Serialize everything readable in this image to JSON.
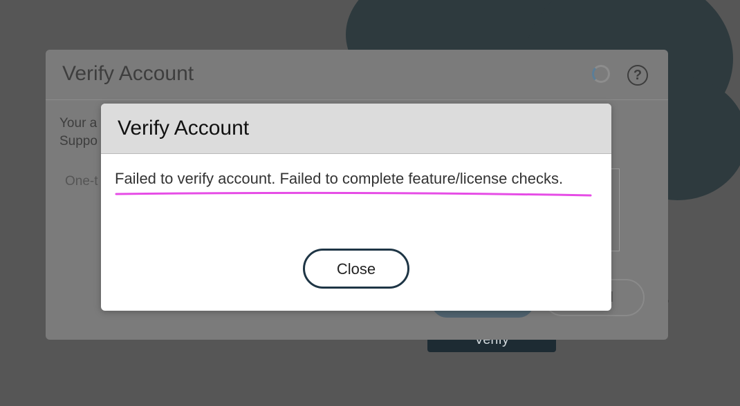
{
  "background": {
    "verify_button_label": "Verify",
    "period": "."
  },
  "dialog_behind": {
    "title": "Verify Account",
    "body_text_visible": "Your a\nSuppo",
    "otp_label_visible": "One-t",
    "cancel_button_label_visible": "el",
    "icons": {
      "spinner": "loading-spinner-icon",
      "help": "help-icon"
    }
  },
  "alert": {
    "title": "Verify Account",
    "message": "Failed to verify account. Failed to complete feature/license checks.",
    "close_label": "Close",
    "underline_color": "#e64ce6",
    "close_border_color": "#1e3545"
  }
}
